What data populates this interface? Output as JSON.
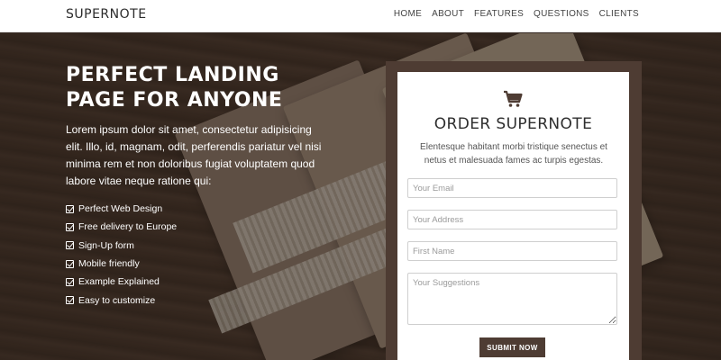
{
  "navbar": {
    "brand": "SUPERNOTE",
    "links": [
      "HOME",
      "ABOUT",
      "FEATURES",
      "QUESTIONS",
      "CLIENTS"
    ]
  },
  "hero": {
    "headline_line1": "PERFECT LANDING",
    "headline_line2": "PAGE FOR ANYONE",
    "intro": "Lorem ipsum dolor sit amet, consectetur adipisicing elit. Illo, id, magnam, odit, perferendis pariatur vel nisi minima rem et non doloribus fugiat voluptatem quod labore vitae neque ratione qui:",
    "features": [
      "Perfect Web Design",
      "Free delivery to Europe",
      "Sign-Up form",
      "Mobile friendly",
      "Example Explained",
      "Easy to customize"
    ]
  },
  "order": {
    "icon": "shopping-cart-icon",
    "title": "ORDER SUPERNOTE",
    "subtitle": "Elentesque habitant morbi tristique senectus et netus et malesuada fames ac turpis egestas.",
    "email_placeholder": "Your Email",
    "email_value": "",
    "address_placeholder": "Your Address",
    "address_value": "",
    "first_name_placeholder": "First Name",
    "first_name_value": "",
    "suggestions_placeholder": "Your Suggestions",
    "suggestions_value": "",
    "submit_label": "SUBMIT NOW"
  },
  "colors": {
    "accent": "#4e3c33",
    "text_dark": "#2e2e2e",
    "white": "#ffffff"
  }
}
